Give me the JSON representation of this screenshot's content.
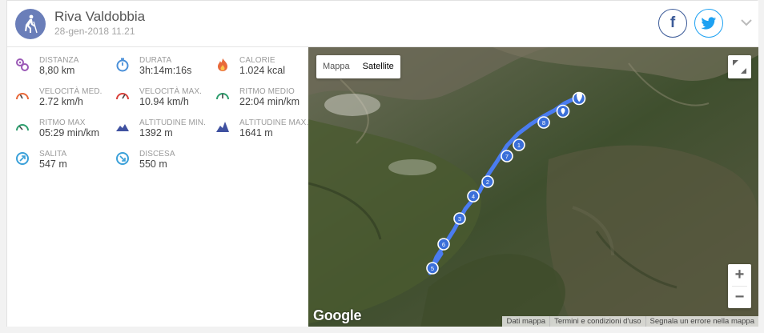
{
  "header": {
    "title": "Riva Valdobbia",
    "date": "28-gen-2018 11.21",
    "facebook_glyph": "f"
  },
  "stats": [
    {
      "label": "DISTANZA",
      "value": "8,80 km",
      "icon": "distance-icon",
      "color": "#9b59b6"
    },
    {
      "label": "DURATA",
      "value": "3h:14m:16s",
      "icon": "stopwatch-icon",
      "color": "#4a90d9"
    },
    {
      "label": "CALORIE",
      "value": "1.024 kcal",
      "icon": "flame-icon",
      "color": "#e8693a"
    },
    {
      "label": "VELOCITÀ MED.",
      "value": "2.72 km/h",
      "icon": "speedometer-icon",
      "color": "#e8693a"
    },
    {
      "label": "VELOCITÀ MAX.",
      "value": "10.94 km/h",
      "icon": "speedometer-max-icon",
      "color": "#d9413a"
    },
    {
      "label": "RITMO MEDIO",
      "value": "22:04 min/km",
      "icon": "pace-icon",
      "color": "#2e9e6e"
    },
    {
      "label": "RITMO MAX",
      "value": "05:29 min/km",
      "icon": "pace-max-icon",
      "color": "#2e9e6e"
    },
    {
      "label": "ALTITUDINE MIN.",
      "value": "1392 m",
      "icon": "mountain-min-icon",
      "color": "#3f51a0"
    },
    {
      "label": "ALTITUDINE MAX.",
      "value": "1641 m",
      "icon": "mountain-max-icon",
      "color": "#3f51a0"
    },
    {
      "label": "SALITA",
      "value": "547 m",
      "icon": "ascent-icon",
      "color": "#3aa0d9"
    },
    {
      "label": "DISCESA",
      "value": "550 m",
      "icon": "descent-icon",
      "color": "#3aa0d9"
    }
  ],
  "map": {
    "type_buttons": [
      "Mappa",
      "Satellite"
    ],
    "active_type": "Satellite",
    "zoom_in": "+",
    "zoom_out": "−",
    "logo": "Google",
    "attribution": [
      "Dati mappa",
      "Termini e condizioni d'uso",
      "Segnala un errore nella mappa"
    ],
    "route_color": "#4a7cf0",
    "markers": [
      "1",
      "2",
      "3",
      "4",
      "5",
      "6",
      "7",
      "8"
    ]
  }
}
